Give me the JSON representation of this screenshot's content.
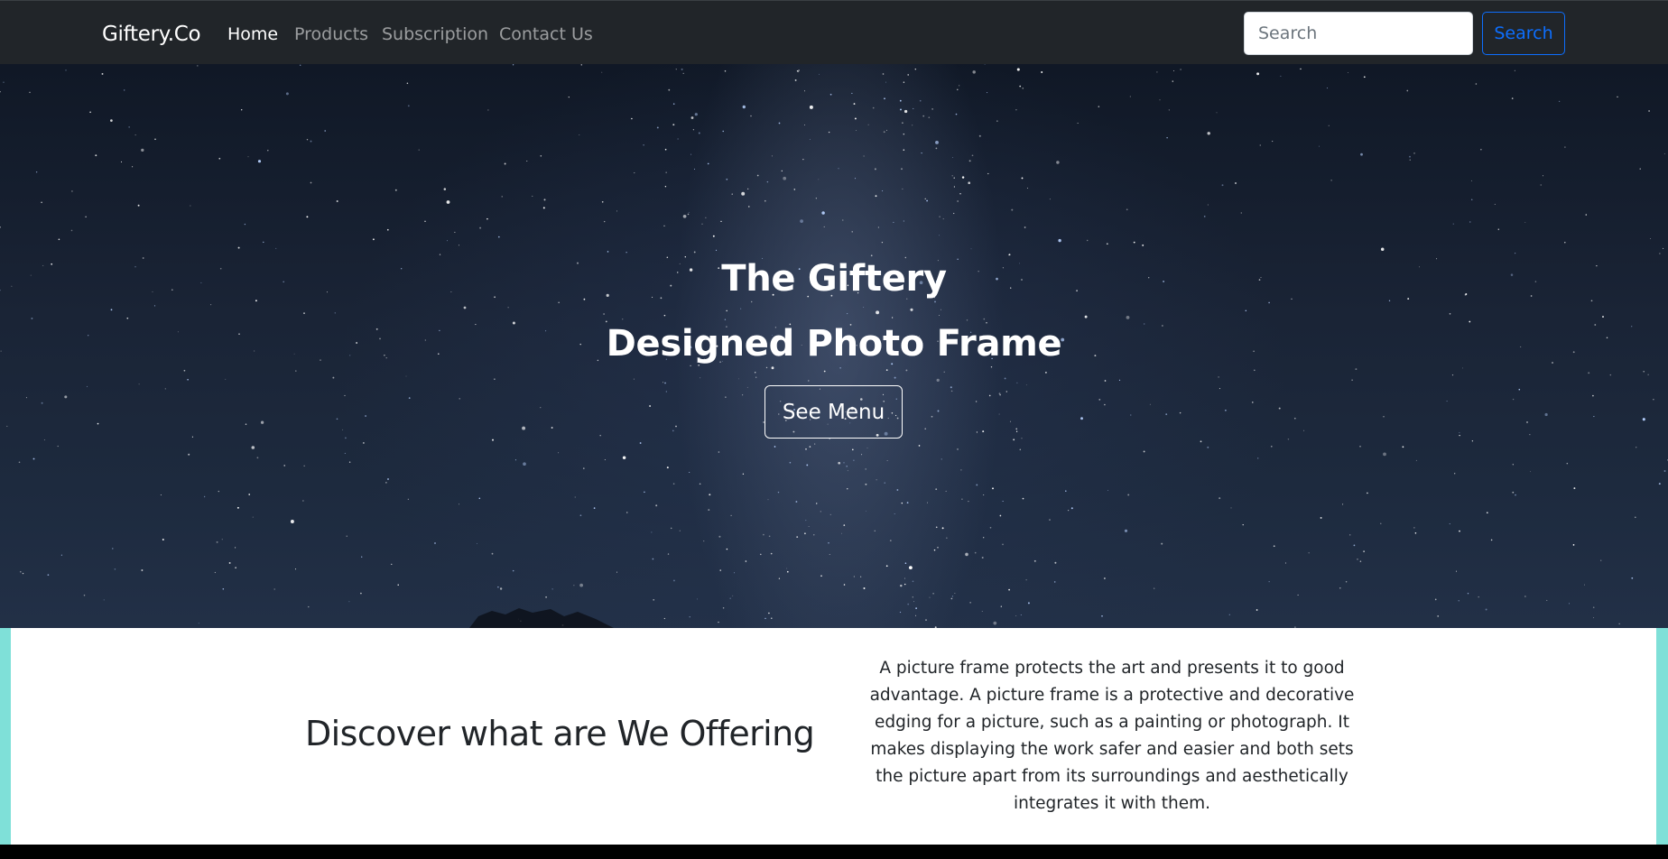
{
  "navbar": {
    "brand": "Giftery.Co",
    "links": [
      {
        "label": "Home",
        "active": true
      },
      {
        "label": "Products",
        "active": false
      },
      {
        "label": "Subscription",
        "active": false
      },
      {
        "label": "Contact Us",
        "active": false
      }
    ],
    "search": {
      "placeholder": "Search",
      "value": "",
      "button_label": "Search"
    }
  },
  "hero": {
    "title_line1": "The Giftery",
    "title_line2": "Designed Photo Frame",
    "button_label": "See Menu",
    "background": "starry-night-sky-image"
  },
  "offer": {
    "heading": "Discover what are We Offering",
    "text": "A picture frame protects the art and presents it to good advantage. A picture frame is a protective and decorative edging for a picture, such as a painting or photograph. It makes displaying the work safer and easier and both sets the picture apart from its surroundings and aesthetically integrates it with them."
  },
  "colors": {
    "navbar_bg": "#212529",
    "accent_blue": "#0d6efd",
    "side_stripe": "#7fe0d8"
  }
}
